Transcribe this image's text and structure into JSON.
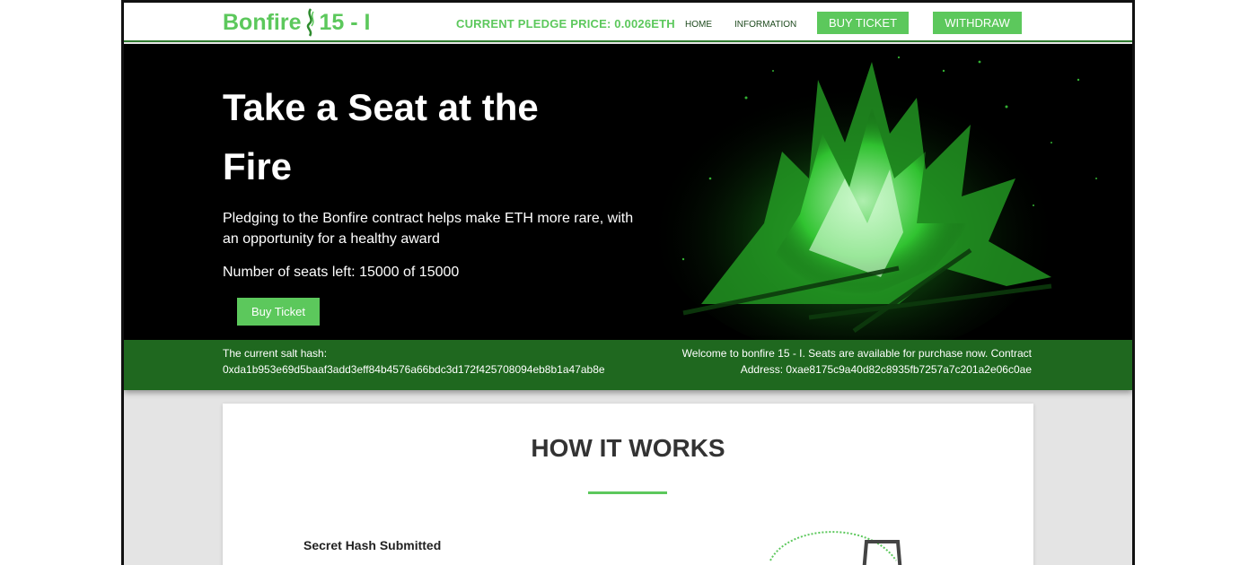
{
  "header": {
    "logo_left": "Bonfire",
    "logo_right": "15 - I",
    "pledge_text": "CURRENT PLEDGE PRICE: 0.0026ETH",
    "nav": {
      "home": "HOME",
      "information": "INFORMATION",
      "buy_ticket": "BUY TICKET",
      "withdraw": "WITHDRAW"
    }
  },
  "hero": {
    "title": "Take a Seat at the Fire",
    "description": "Pledging to the Bonfire contract helps make ETH more rare, with an opportunity for a healthy award",
    "seats": "Number of seats left: 15000 of 15000",
    "button": "Buy Ticket"
  },
  "info": {
    "salt_label": "The current salt hash:",
    "salt_hash": "0xda1b953e69d5baaf3add3eff84b4576a66bdc3d172f425708094eb8b1a47ab8e",
    "welcome_line1": "Welcome to bonfire 15 - I. Seats are available for purchase now. Contract",
    "welcome_line2": "Address: 0xae8175c9a40d82c8935fb7257a7c201a2e06c0ae"
  },
  "how": {
    "title": "HOW IT WORKS",
    "step1": "Secret Hash Submitted"
  },
  "colors": {
    "accent": "#5cc85c",
    "infobar": "#1f681f",
    "hero_bg": "#000000"
  },
  "icons": {
    "logo": "flame-icon"
  }
}
